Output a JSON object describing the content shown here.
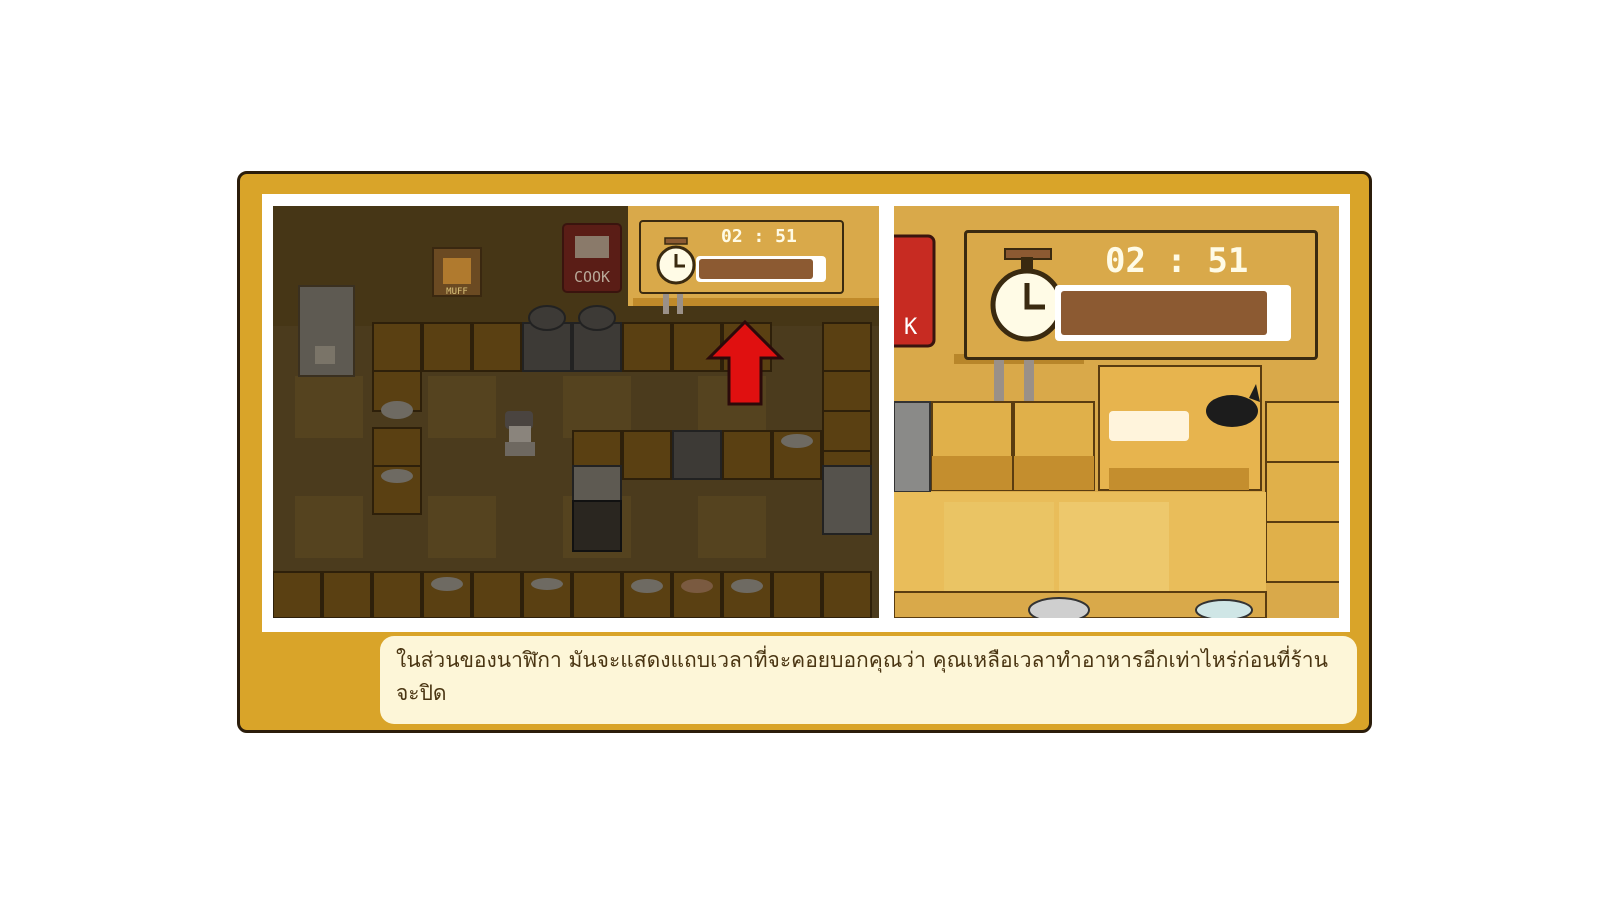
{
  "hud": {
    "timer_text": "02 : 51",
    "time_bar_fraction": 0.92,
    "stove_sign": "COOK",
    "muff_sign": "MUFF"
  },
  "caption": {
    "text": "ในส่วนของนาฬิกา มันจะแสดงแถบเวลาที่จะคอยบอกคุณว่า คุณเหลือเวลาทำอาหารอีกเท่าไหร่ก่อนที่ร้านจะปิด"
  },
  "colors": {
    "frame": "#d9a429",
    "arrow": "#e01010",
    "bar_fill": "#8c5a32",
    "caption_bg": "#fdf6d8"
  }
}
